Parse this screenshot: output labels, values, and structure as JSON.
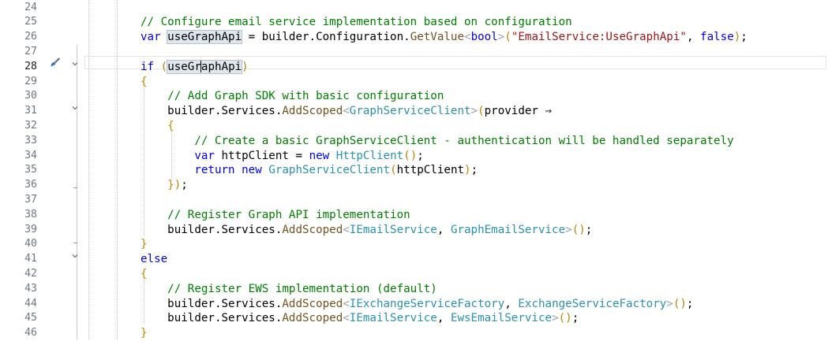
{
  "editor": {
    "current_line": 28,
    "lines": [
      {
        "no": "24",
        "code": ""
      },
      {
        "no": "25",
        "code": "        // Configure email service implementation based on configuration"
      },
      {
        "no": "26",
        "code": "        var useGraphApi = builder.Configuration.GetValue<bool>(\"EmailService:UseGraphApi\", false);"
      },
      {
        "no": "27",
        "code": ""
      },
      {
        "no": "28",
        "code": "        if (useGraphApi)"
      },
      {
        "no": "29",
        "code": "        {"
      },
      {
        "no": "30",
        "code": "            // Add Graph SDK with basic configuration"
      },
      {
        "no": "31",
        "code": "            builder.Services.AddScoped<GraphServiceClient>(provider =>"
      },
      {
        "no": "32",
        "code": "            {"
      },
      {
        "no": "33",
        "code": "                // Create a basic GraphServiceClient - authentication will be handled separately"
      },
      {
        "no": "34",
        "code": "                var httpClient = new HttpClient();"
      },
      {
        "no": "35",
        "code": "                return new GraphServiceClient(httpClient);"
      },
      {
        "no": "36",
        "code": "            });"
      },
      {
        "no": "37",
        "code": ""
      },
      {
        "no": "38",
        "code": "            // Register Graph API implementation"
      },
      {
        "no": "39",
        "code": "            builder.Services.AddScoped<IEmailService, GraphEmailService>();"
      },
      {
        "no": "40",
        "code": "        }"
      },
      {
        "no": "41",
        "code": "        else"
      },
      {
        "no": "42",
        "code": "        {"
      },
      {
        "no": "43",
        "code": "            // Register EWS implementation (default)"
      },
      {
        "no": "44",
        "code": "            builder.Services.AddScoped<IExchangeServiceFactory, ExchangeServiceFactory>();"
      },
      {
        "no": "45",
        "code": "            builder.Services.AddScoped<IEmailService, EwsEmailService>();"
      },
      {
        "no": "46",
        "code": "        }"
      }
    ]
  },
  "colors": {
    "keyword": "#0000ff",
    "comment": "#008000",
    "type": "#2b91af",
    "string": "#a31515",
    "method": "#74531f",
    "line_number": "#6e7681"
  },
  "icons": {
    "quick_action": "paintbrush-icon",
    "fold": "chevron-down-icon"
  }
}
